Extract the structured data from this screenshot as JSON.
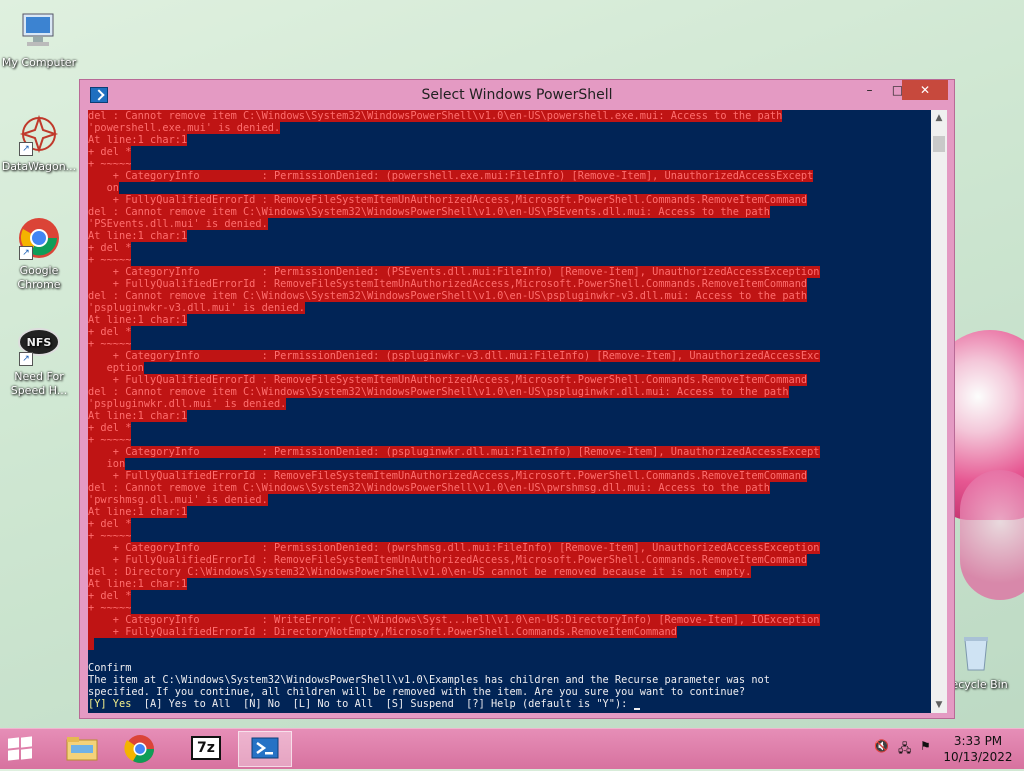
{
  "desktop": {
    "icons": [
      {
        "label": "My Computer",
        "icon": "computer-icon"
      },
      {
        "label": "DataWagon...",
        "icon": "datawagon-icon"
      },
      {
        "label": "Google Chrome",
        "icon": "chrome-icon"
      },
      {
        "label": "Need For Speed H...",
        "icon": "nfs-icon"
      },
      {
        "label": "Recycle Bin",
        "icon": "recycle-bin-icon"
      }
    ]
  },
  "window": {
    "title": "Select Windows PowerShell",
    "minimize": "–",
    "maximize": "□",
    "close": "✕"
  },
  "console": {
    "error_lines": [
      "del : Cannot remove item C:\\Windows\\System32\\WindowsPowerShell\\v1.0\\en-US\\powershell.exe.mui: Access to the path",
      "'powershell.exe.mui' is denied.",
      "At line:1 char:1",
      "+ del *",
      "+ ~~~~~",
      "    + CategoryInfo          : PermissionDenied: (powershell.exe.mui:FileInfo) [Remove-Item], UnauthorizedAccessExcept",
      "   on",
      "    + FullyQualifiedErrorId : RemoveFileSystemItemUnAuthorizedAccess,Microsoft.PowerShell.Commands.RemoveItemCommand",
      "del : Cannot remove item C:\\Windows\\System32\\WindowsPowerShell\\v1.0\\en-US\\PSEvents.dll.mui: Access to the path",
      "'PSEvents.dll.mui' is denied.",
      "At line:1 char:1",
      "+ del *",
      "+ ~~~~~",
      "    + CategoryInfo          : PermissionDenied: (PSEvents.dll.mui:FileInfo) [Remove-Item], UnauthorizedAccessException",
      "    + FullyQualifiedErrorId : RemoveFileSystemItemUnAuthorizedAccess,Microsoft.PowerShell.Commands.RemoveItemCommand",
      "del : Cannot remove item C:\\Windows\\System32\\WindowsPowerShell\\v1.0\\en-US\\pspluginwkr-v3.dll.mui: Access to the path",
      "'pspluginwkr-v3.dll.mui' is denied.",
      "At line:1 char:1",
      "+ del *",
      "+ ~~~~~",
      "    + CategoryInfo          : PermissionDenied: (pspluginwkr-v3.dll.mui:FileInfo) [Remove-Item], UnauthorizedAccessExc",
      "   eption",
      "    + FullyQualifiedErrorId : RemoveFileSystemItemUnAuthorizedAccess,Microsoft.PowerShell.Commands.RemoveItemCommand",
      "del : Cannot remove item C:\\Windows\\System32\\WindowsPowerShell\\v1.0\\en-US\\pspluginwkr.dll.mui: Access to the path",
      "'pspluginwkr.dll.mui' is denied.",
      "At line:1 char:1",
      "+ del *",
      "+ ~~~~~",
      "    + CategoryInfo          : PermissionDenied: (pspluginwkr.dll.mui:FileInfo) [Remove-Item], UnauthorizedAccessExcept",
      "   ion",
      "    + FullyQualifiedErrorId : RemoveFileSystemItemUnAuthorizedAccess,Microsoft.PowerShell.Commands.RemoveItemCommand",
      "del : Cannot remove item C:\\Windows\\System32\\WindowsPowerShell\\v1.0\\en-US\\pwrshmsg.dll.mui: Access to the path",
      "'pwrshmsg.dll.mui' is denied.",
      "At line:1 char:1",
      "+ del *",
      "+ ~~~~~",
      "    + CategoryInfo          : PermissionDenied: (pwrshmsg.dll.mui:FileInfo) [Remove-Item], UnauthorizedAccessException",
      "    + FullyQualifiedErrorId : RemoveFileSystemItemUnAuthorizedAccess,Microsoft.PowerShell.Commands.RemoveItemCommand",
      "del : Directory C:\\Windows\\System32\\WindowsPowerShell\\v1.0\\en-US cannot be removed because it is not empty.",
      "At line:1 char:1",
      "+ del *",
      "+ ~~~~~",
      "    + CategoryInfo          : WriteError: (C:\\Windows\\Syst...hell\\v1.0\\en-US:DirectoryInfo) [Remove-Item], IOException",
      "    + FullyQualifiedErrorId : DirectoryNotEmpty,Microsoft.PowerShell.Commands.RemoveItemCommand",
      " "
    ],
    "confirm_title": "Confirm",
    "confirm_line1": "The item at C:\\Windows\\System32\\WindowsPowerShell\\v1.0\\Examples has children and the Recurse parameter was not",
    "confirm_line2": "specified. If you continue, all children will be removed with the item. Are you sure you want to continue?",
    "prompt_yes": "[Y] Yes",
    "prompt_rest": "  [A] Yes to All  [N] No  [L] No to All  [S] Suspend  [?] Help (default is \"Y\"): "
  },
  "taskbar": {
    "buttons": [
      {
        "name": "file-explorer-icon"
      },
      {
        "name": "chrome-icon"
      },
      {
        "name": "7zip-icon",
        "label": "7z"
      },
      {
        "name": "powershell-icon"
      }
    ],
    "time": "3:33 PM",
    "date": "10/13/2022"
  },
  "colors": {
    "console_bg": "#012456",
    "error_bg": "#bf1414",
    "error_fg": "#ff6e6e",
    "accent": "#e49ac3",
    "prompt_yellow": "#f6f28c"
  }
}
